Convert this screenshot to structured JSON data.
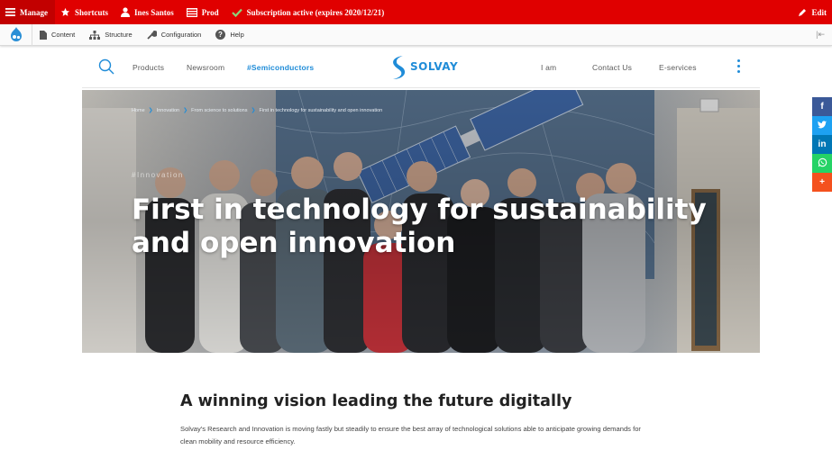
{
  "admin_bar": {
    "manage": "Manage",
    "shortcuts": "Shortcuts",
    "user": "Ines Santos",
    "env": "Prod",
    "subscription": "Subscription active (expires 2020/12/21)",
    "edit": "Edit"
  },
  "sub_bar": {
    "items": [
      "Content",
      "Structure",
      "Configuration",
      "Help"
    ],
    "toggle": "|⇤"
  },
  "nav": {
    "links": [
      "Products",
      "Newsroom",
      "#Semiconductors"
    ],
    "right_links": [
      "I am",
      "Contact Us",
      "E-services"
    ],
    "logo": "SOLVAY"
  },
  "hero": {
    "breadcrumb": [
      "Home",
      "Innovation",
      "From science to solutions",
      "First in technology for sustainability and open innovation"
    ],
    "tag": "#Innovation",
    "title": "First in technology for sustainability and open innovation"
  },
  "share": [
    {
      "icon": "facebook-icon",
      "glyph": "f",
      "color": "#3b5998"
    },
    {
      "icon": "twitter-icon",
      "glyph": "t",
      "color": "#1da1f2"
    },
    {
      "icon": "linkedin-icon",
      "glyph": "in",
      "color": "#0077b5"
    },
    {
      "icon": "whatsapp-icon",
      "glyph": "w",
      "color": "#25d366"
    },
    {
      "icon": "more-share-icon",
      "glyph": "+",
      "color": "#f4511e"
    }
  ],
  "article": {
    "title": "A winning vision leading the future digitally",
    "body": "Solvay's Research and Innovation is moving fastly but steadily to ensure the best array of technological solutions able to anticipate growing demands for clean mobility and resource efficiency."
  },
  "colors": {
    "admin_red": "#e00000",
    "brand_blue": "#1f8cd8"
  }
}
